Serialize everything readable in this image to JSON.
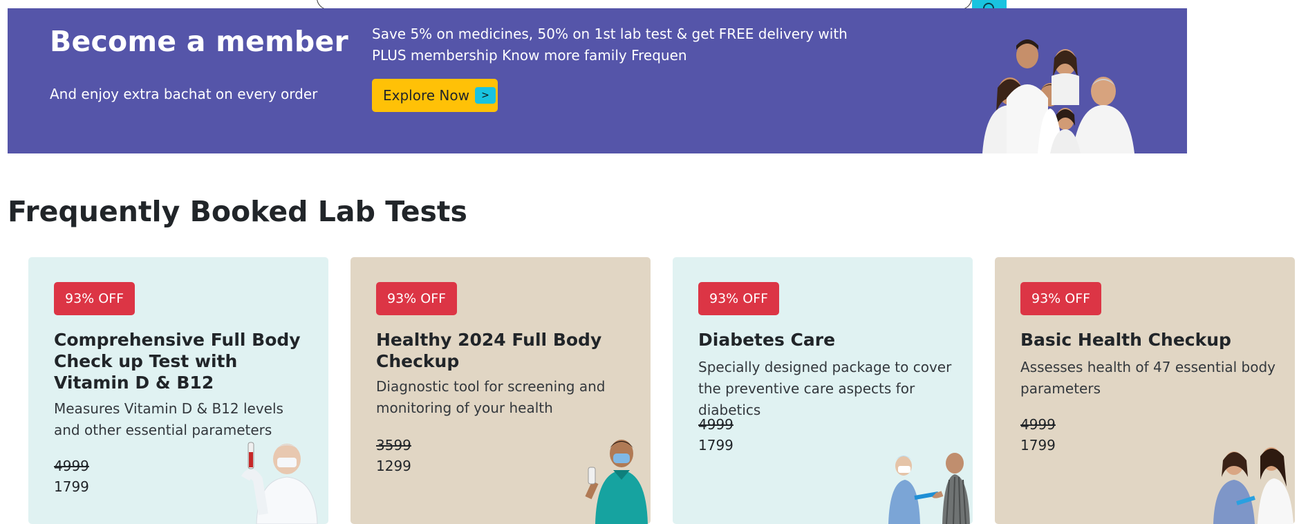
{
  "banner": {
    "title": "Become a member",
    "subtitle": "And enjoy extra bachat on every order",
    "offer_text": "Save 5% on medicines, 50% on 1st lab test & get FREE delivery with PLUS membership Know more family Frequen",
    "button_label": "Explore Now",
    "button_arrow": ">",
    "colors": {
      "background": "#5555a9",
      "button": "#ffc107",
      "arrow_box": "#19c3e0"
    }
  },
  "section": {
    "title": "Frequently Booked Lab Tests"
  },
  "cards": [
    {
      "badge": "93% OFF",
      "title": "Comprehensive Full Body Check up Test with Vitamin D & B12",
      "description": "Measures Vitamin D & B12 levels and other essential parameters",
      "old_price": "4999",
      "new_price": "1799",
      "image": "lab-scientist-image"
    },
    {
      "badge": "93% OFF",
      "title": "Healthy 2024 Full Body Checkup",
      "description": "Diagnostic tool for screening and monitoring of your health",
      "old_price": "3599",
      "new_price": "1299",
      "image": "masked-man-image"
    },
    {
      "badge": "93% OFF",
      "title": "Diabetes Care",
      "description": "Specially designed package to cover the preventive care aspects for diabetics",
      "old_price": "4999",
      "new_price": "1799",
      "image": "nurse-patient-image"
    },
    {
      "badge": "93% OFF",
      "title": "Basic Health Checkup",
      "description": "Assesses health of 47 essential body parameters",
      "old_price": "4999",
      "new_price": "1799",
      "image": "blood-draw-image"
    }
  ],
  "colors": {
    "badge": "#dc3545",
    "card_teal": "#e0f2f2",
    "card_beige": "#e1d6c4"
  }
}
